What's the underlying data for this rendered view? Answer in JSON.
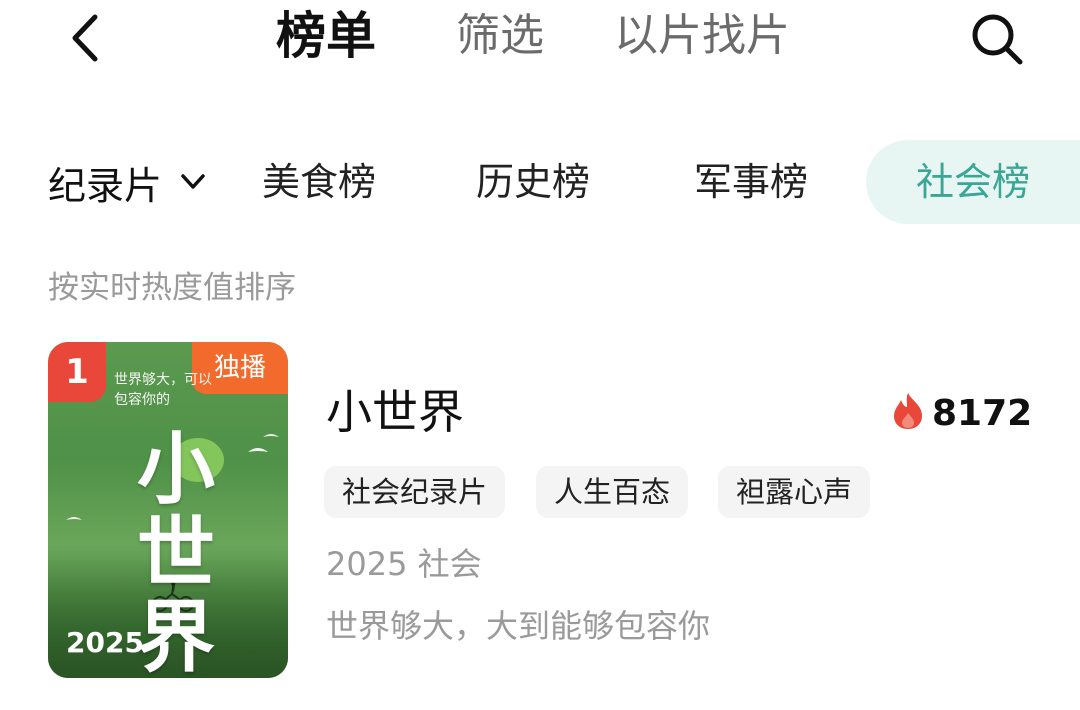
{
  "header": {
    "back_icon": "chevron-left-icon",
    "tabs": [
      {
        "label": "榜单",
        "active": true
      },
      {
        "label": "筛选",
        "active": false
      },
      {
        "label": "以片找片",
        "active": false
      }
    ],
    "search_icon": "search-icon"
  },
  "categories": {
    "dropdown_label": "纪录片",
    "dropdown_icon": "chevron-down-icon",
    "tabs": [
      {
        "label": "美食榜",
        "active": false
      },
      {
        "label": "历史榜",
        "active": false
      },
      {
        "label": "军事榜",
        "active": false
      },
      {
        "label": "社会榜",
        "active": true
      }
    ],
    "active_color": "#3aa695"
  },
  "sort_label": "按实时热度值排序",
  "items": [
    {
      "rank": "1",
      "badge": "独播",
      "poster": {
        "tagline": "世界够大，可以包容你的",
        "title": "小世界",
        "year": "2025"
      },
      "title": "小世界",
      "heat_icon": "flame-icon",
      "heat": "8172",
      "tags": [
        "社会纪录片",
        "人生百态",
        "袒露心声"
      ],
      "meta": "2025 社会",
      "description": "世界够大，大到能够包容你"
    }
  ],
  "colors": {
    "rank_badge": "#e8473a",
    "exclusive_badge": "#f26b2c",
    "flame": "#e8473a"
  }
}
